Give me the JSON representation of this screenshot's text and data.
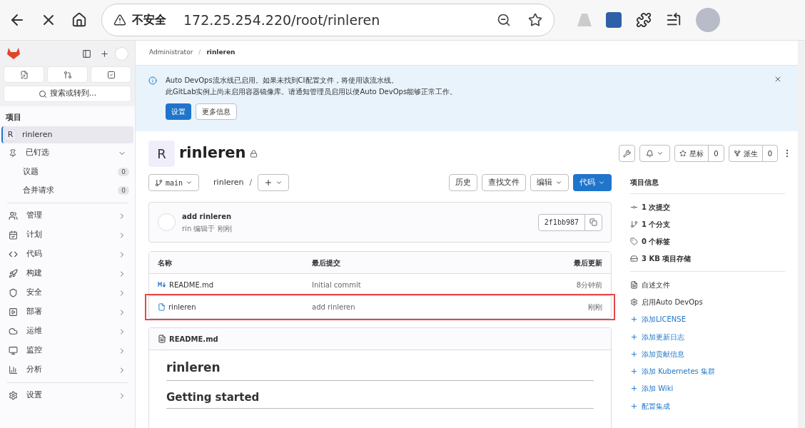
{
  "browser": {
    "security_label": "不安全",
    "url": "172.25.254.220/root/rinleren"
  },
  "sidebar": {
    "search_placeholder": "搜索或转到...",
    "section_title": "项目",
    "project": {
      "avatar": "R",
      "name": "rinleren",
      "selected": true
    },
    "pinned": {
      "label": "已钉选",
      "expanded": true,
      "children": [
        {
          "label": "议题",
          "count": "0"
        },
        {
          "label": "合并请求",
          "count": "0"
        }
      ]
    },
    "nav": [
      {
        "kind": "manage",
        "label": "管理"
      },
      {
        "kind": "plan",
        "label": "计划"
      },
      {
        "kind": "code",
        "label": "代码"
      },
      {
        "kind": "build",
        "label": "构建"
      },
      {
        "kind": "secure",
        "label": "安全"
      },
      {
        "kind": "deploy",
        "label": "部署"
      },
      {
        "kind": "operate",
        "label": "运维"
      },
      {
        "kind": "monitor",
        "label": "监控"
      },
      {
        "kind": "analyze",
        "label": "分析"
      }
    ],
    "settings": {
      "kind": "settings",
      "label": "设置"
    }
  },
  "breadcrumb": [
    "Administrator",
    "rinleren"
  ],
  "breadcrumb_separator": "/",
  "alert": {
    "lines": [
      "Auto DevOps流水线已启用。如果未找到CI配置文件，将使用该流水线。",
      "此GitLab实例上尚未启用容器镜像库。请通知管理员启用以便Auto DevOps能够正常工作。"
    ],
    "primary_button": "设置",
    "secondary_button": "更多信息"
  },
  "project": {
    "avatar": "R",
    "name": "rinleren",
    "star": {
      "label": "星标",
      "count": "0"
    },
    "fork": {
      "label": "派生",
      "count": "0"
    }
  },
  "repo_toolbar": {
    "branch": "main",
    "path": "rinleren",
    "separator": "/",
    "history": "历史",
    "find_file": "查找文件",
    "edit": "编辑",
    "code": "代码"
  },
  "last_commit": {
    "title": "add rinleren",
    "meta": "rin 编辑于 刚刚",
    "sha": "2f1bb987"
  },
  "table": {
    "columns": [
      "名称",
      "最后提交",
      "最后更新"
    ],
    "rows": [
      {
        "kind": "markdown",
        "name": "README.md",
        "commit": "Initial commit",
        "updated": "8分钟前",
        "highlighted": false
      },
      {
        "kind": "file",
        "name": "rinleren",
        "commit": "add rinleren",
        "updated": "刚刚",
        "highlighted": true
      }
    ]
  },
  "readme": {
    "title": "README.md",
    "headings": [
      "rinleren",
      "Getting started"
    ]
  },
  "project_info": {
    "title": "项目信息",
    "stats": [
      {
        "kind": "commit",
        "text": "1 次提交"
      },
      {
        "kind": "branch",
        "text": "1 个分支"
      },
      {
        "kind": "tag",
        "text": "0 个标签"
      },
      {
        "kind": "storage",
        "text": "3 KB 项目存储"
      }
    ],
    "links": [
      {
        "kind": "file",
        "text": "自述文件"
      },
      {
        "kind": "gear",
        "text": "启用Auto DevOps"
      },
      {
        "kind": "add",
        "text": "添加LICENSE"
      },
      {
        "kind": "add",
        "text": "添加更新日志"
      },
      {
        "kind": "add",
        "text": "添加贡献信息"
      },
      {
        "kind": "add",
        "text": "添加 Kubernetes 集群"
      },
      {
        "kind": "add",
        "text": "添加 Wiki"
      },
      {
        "kind": "add",
        "text": "配置集成"
      }
    ]
  }
}
